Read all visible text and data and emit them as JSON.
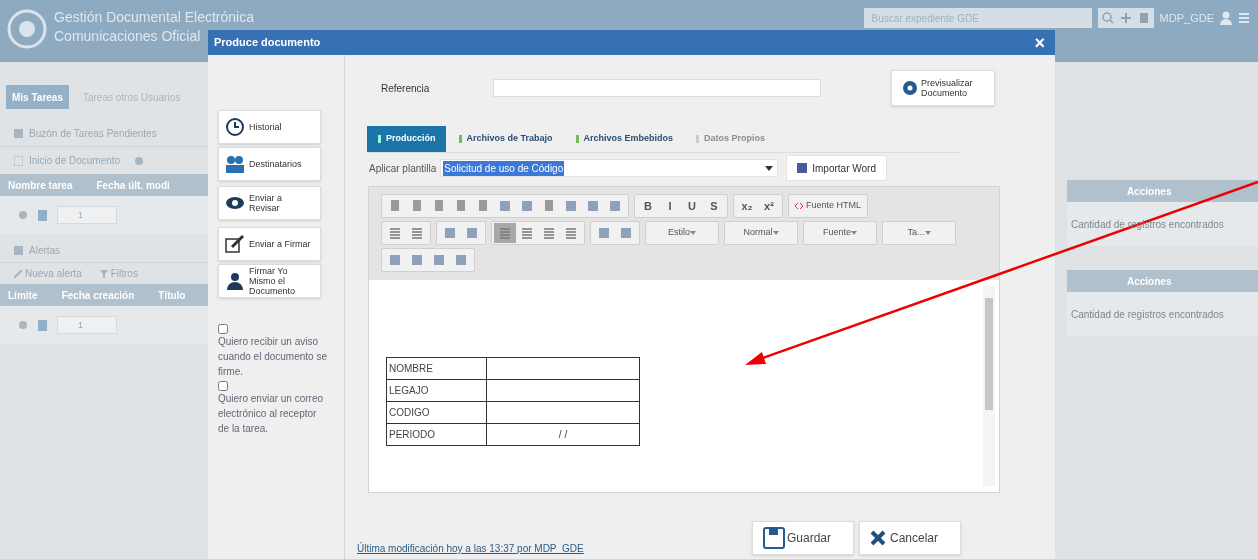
{
  "header": {
    "title_line_1": "Gestión Documental Electrónica",
    "title_line_2": "Comunicaciones Oficial",
    "search": {
      "placeholder": "Buscar expediente GDE"
    },
    "user": "MDP_GDE"
  },
  "left_panel": {
    "tabs": [
      {
        "label": "Mis Tareas",
        "selected": true
      },
      {
        "label": "Tareas otros Usuarios",
        "selected": false
      }
    ],
    "inbox_title": "Buzón de Tareas Pendientes",
    "start_document": "Inicio de Documento",
    "tasks_table": {
      "columns": [
        "Nombre tarea",
        "Fecha últ. modi"
      ],
      "page": "1"
    },
    "alerts_title": "Alertas",
    "alert_actions": [
      "Nueva alerta",
      "Filtros"
    ],
    "alerts_table": {
      "columns": [
        "Límite",
        "Fecha creación",
        "Título"
      ],
      "page": "1"
    }
  },
  "right_panel": {
    "tables": [
      {
        "column": "Acciones",
        "message": "Cantidad de registros encontrados"
      },
      {
        "column": "Acciones",
        "message": "Cantidad de registros encontrados"
      }
    ]
  },
  "dialog": {
    "title": "Produce documento",
    "close": "×",
    "actions": [
      {
        "kind": "history",
        "label": "Historial"
      },
      {
        "kind": "recipients",
        "label": "Destinatarios"
      },
      {
        "kind": "review",
        "label": "Enviar a Revisar"
      },
      {
        "kind": "sign",
        "label": "Enviar a Firmar"
      },
      {
        "kind": "self_sign",
        "label": "Firmar Yo Mismo el Documento"
      }
    ],
    "options": [
      {
        "label": "Quiero recibir un aviso cuando el documento se firme.",
        "checked": false
      },
      {
        "label": "Quiero enviar un correo electrónico al receptor de la tarea.",
        "checked": false
      }
    ],
    "reference": {
      "label": "Referencia"
    },
    "preview_button": "Previsualizar Documento",
    "tabs": [
      {
        "label": "Producción",
        "selected": true,
        "disabled": false
      },
      {
        "label": "Archivos de Trabajo",
        "selected": false,
        "disabled": false
      },
      {
        "label": "Archivos Embebidos",
        "selected": false,
        "disabled": false
      },
      {
        "label": "Datos Propios",
        "selected": false,
        "disabled": true
      }
    ],
    "template": {
      "label": "Aplicar plantilla",
      "value": "Solicitud de uso de Código"
    },
    "import_button": "Importar Word",
    "toolbar": [
      [
        {
          "items": [
            {
              "kind": "page"
            },
            {
              "kind": "page"
            },
            {
              "kind": "page"
            },
            {
              "kind": "page"
            },
            {
              "kind": "page"
            },
            {
              "kind": "square"
            },
            {
              "kind": "square"
            },
            {
              "kind": "page"
            },
            {
              "kind": "square"
            },
            {
              "kind": "square"
            },
            {
              "kind": "square"
            }
          ]
        },
        {
          "items": [
            {
              "kind": "glyph",
              "text": "B"
            },
            {
              "kind": "glyph",
              "text": "I"
            },
            {
              "kind": "glyph",
              "text": "U"
            },
            {
              "kind": "glyph",
              "text": "S"
            }
          ]
        },
        {
          "items": [
            {
              "kind": "glyph",
              "text": "x₂"
            },
            {
              "kind": "glyph",
              "text": "x²"
            }
          ]
        },
        {
          "items": [
            {
              "kind": "label",
              "text": "Fuente HTML"
            }
          ]
        }
      ],
      [
        {
          "items": [
            {
              "kind": "lines"
            },
            {
              "kind": "lines"
            }
          ]
        },
        {
          "items": [
            {
              "kind": "square"
            },
            {
              "kind": "square"
            }
          ]
        },
        {
          "items": [
            {
              "kind": "lines",
              "selected": true
            },
            {
              "kind": "lines",
              "selected": false
            },
            {
              "kind": "lines",
              "selected": false
            },
            {
              "kind": "lines",
              "selected": false
            }
          ]
        },
        {
          "items": [
            {
              "kind": "square"
            },
            {
              "kind": "square"
            }
          ]
        },
        {
          "items": [
            {
              "kind": "dropdown",
              "text": "Estilo"
            }
          ]
        },
        {
          "items": [
            {
              "kind": "dropdown",
              "text": "Normal"
            }
          ]
        },
        {
          "items": [
            {
              "kind": "dropdown",
              "text": "Fuente"
            }
          ]
        },
        {
          "items": [
            {
              "kind": "dropdown",
              "text": "Ta..."
            }
          ]
        }
      ],
      [
        {
          "items": [
            {
              "kind": "square"
            },
            {
              "kind": "square"
            },
            {
              "kind": "square"
            },
            {
              "kind": "square"
            }
          ]
        }
      ]
    ],
    "document_table": [
      {
        "label": "NOMBRE"
      },
      {
        "label": "LEGAJO"
      },
      {
        "label": "CODIGO"
      },
      {
        "label": "PERIODO",
        "value": "/ /"
      }
    ],
    "last_modified": "Última modificación hoy a las 13:37 por MDP_GDE",
    "save_button": "Guardar",
    "cancel_button": "Cancelar"
  }
}
